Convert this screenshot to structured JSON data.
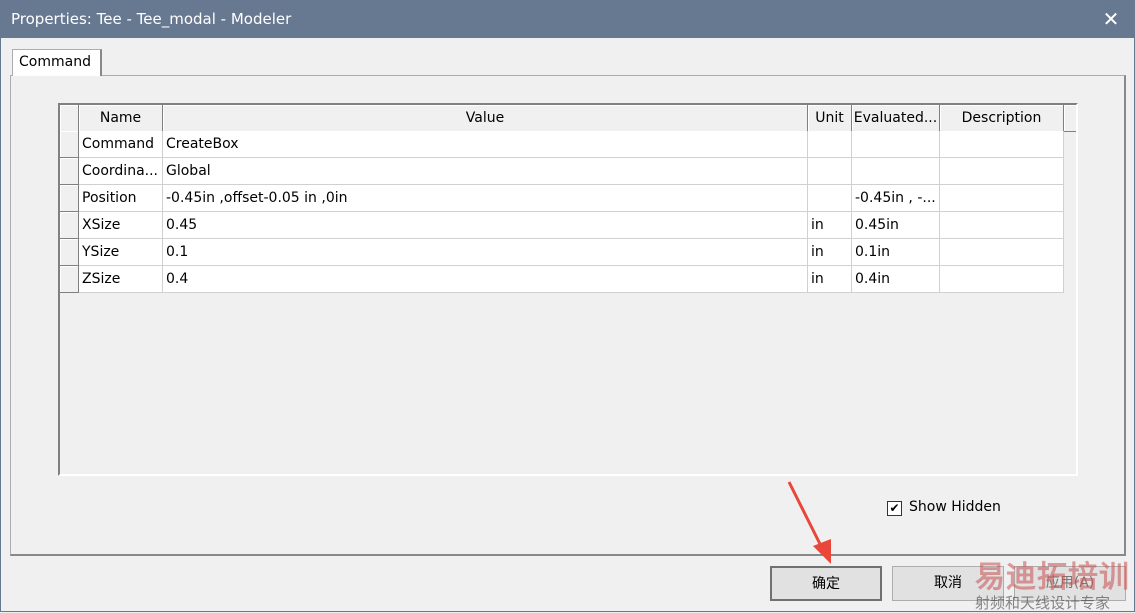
{
  "window": {
    "title": "Properties: Tee - Tee_modal - Modeler",
    "close_icon": "close-icon"
  },
  "tabs": [
    {
      "label": "Command",
      "active": true
    }
  ],
  "table": {
    "columns": [
      "Name",
      "Value",
      "Unit",
      "Evaluated...",
      "Description"
    ],
    "rows": [
      {
        "name": "Command",
        "value": "CreateBox",
        "unit": "",
        "evaluated": "",
        "description": ""
      },
      {
        "name": "Coordina...",
        "value": "Global",
        "unit": "",
        "evaluated": "",
        "description": ""
      },
      {
        "name": "Position",
        "value": "-0.45in ,offset-0.05 in ,0in",
        "unit": "",
        "evaluated": "-0.45in , -...",
        "description": ""
      },
      {
        "name": "XSize",
        "value": "0.45",
        "unit": "in",
        "evaluated": "0.45in",
        "description": ""
      },
      {
        "name": "YSize",
        "value": "0.1",
        "unit": "in",
        "evaluated": "0.1in",
        "description": ""
      },
      {
        "name": "ZSize",
        "value": "0.4",
        "unit": "in",
        "evaluated": "0.4in",
        "description": ""
      }
    ]
  },
  "show_hidden": {
    "label": "Show Hidden",
    "checked": true
  },
  "buttons": {
    "ok": "确定",
    "cancel": "取消",
    "apply": "应用(A)"
  },
  "watermark": {
    "line1": "易迪拓培训",
    "line2": "射频和天线设计专家"
  },
  "annotation": {
    "arrow_color": "#e8473a"
  }
}
